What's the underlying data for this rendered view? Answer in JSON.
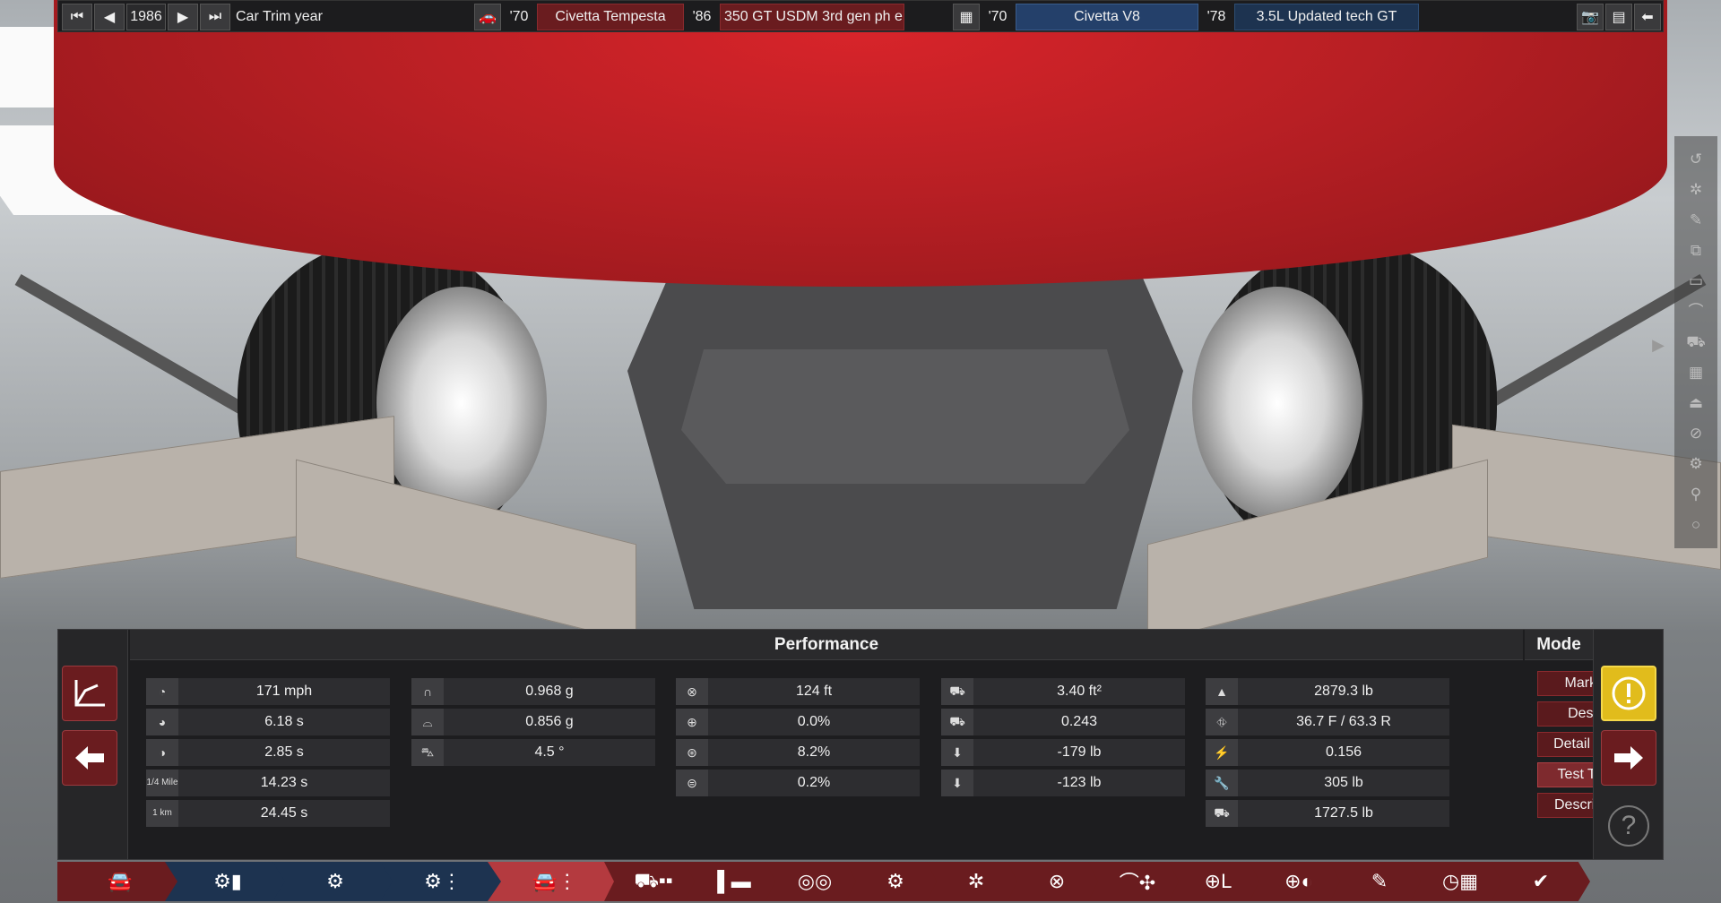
{
  "topbar": {
    "year": "1986",
    "year_label": "Car Trim year",
    "model_year": "'70",
    "model_name": "Civetta Tempesta",
    "trim_year": "'86",
    "trim_name": "350 GT USDM 3rd gen ph e",
    "engine_year": "'70",
    "engine_name": "Civetta V8",
    "variant_year": "'78",
    "variant_name": "3.5L Updated tech GT"
  },
  "performance": {
    "title": "Performance",
    "col1": [
      {
        "icon": "speedometer-icon",
        "value": "171 mph"
      },
      {
        "icon": "acceleration-60-icon",
        "value": "6.18 s"
      },
      {
        "icon": "acceleration-80-icon",
        "value": "2.85 s"
      },
      {
        "icon": "quarter-mile-icon",
        "icon_text": "1/4 Mile",
        "value": "14.23 s"
      },
      {
        "icon": "one-km-icon",
        "icon_text": "1 km",
        "value": "24.45 s"
      }
    ],
    "col2": [
      {
        "icon": "lateral-g-icon",
        "value": "0.968 g"
      },
      {
        "icon": "lateral-g-low-icon",
        "value": "0.856 g"
      },
      {
        "icon": "body-roll-icon",
        "value": "4.5 °"
      }
    ],
    "col3": [
      {
        "icon": "braking-distance-icon",
        "value": "124 ft"
      },
      {
        "icon": "understeer-icon",
        "value": "0.0%"
      },
      {
        "icon": "oversteer-icon",
        "value": "8.2%"
      },
      {
        "icon": "wheelspin-icon",
        "value": "0.2%"
      }
    ],
    "col4": [
      {
        "icon": "frontal-area-icon",
        "value": "3.40 ft²"
      },
      {
        "icon": "drag-coefficient-icon",
        "value": "0.243"
      },
      {
        "icon": "front-downforce-icon",
        "value": "-179 lb"
      },
      {
        "icon": "rear-downforce-icon",
        "value": "-123 lb"
      }
    ],
    "col5": [
      {
        "icon": "weight-icon",
        "value": "2879.3 lb"
      },
      {
        "icon": "weight-distribution-icon",
        "value": "36.7 F / 63.3 R"
      },
      {
        "icon": "lift-icon",
        "value": "0.156"
      },
      {
        "icon": "service-icon",
        "value": "305 lb"
      },
      {
        "icon": "towing-icon",
        "value": "1727.5 lb"
      }
    ]
  },
  "mode": {
    "title": "Mode",
    "items": [
      "Markets",
      "Design",
      "Detail Stats",
      "Test Track",
      "Description"
    ],
    "active_index": 3
  },
  "help": {
    "label": "?"
  },
  "tabs": [
    "car-model-icon",
    "engine-family-icon",
    "engine-variant-icon",
    "engine-tune-icon",
    "trim-icon",
    "chassis-icon",
    "suspension-icon",
    "bodywork-icon",
    "gearbox-icon",
    "wheels-icon",
    "brakes-icon",
    "aero-icon",
    "interior-icon",
    "safety-icon",
    "tuning-icon",
    "testing-icon",
    "finish-icon"
  ]
}
